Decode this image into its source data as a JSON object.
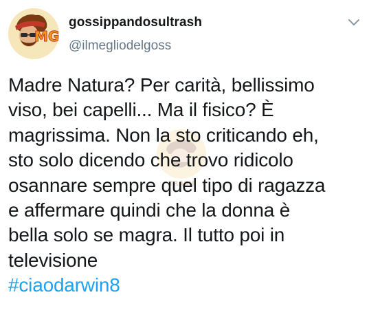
{
  "tweet": {
    "display_name": "gossippandosultrash",
    "handle": "@ilmegliodelgoss",
    "avatar_icon": "avatar-logo-mg",
    "menu_icon": "chevron-down-icon",
    "avatar_text": "MG",
    "body_lines": [
      "Madre Natura? Per carità, bellissimo",
      "viso, bei capelli... Ma il fisico? È",
      "magrissima. Non la sto criticando eh,",
      "sto solo dicendo che trovo ridicolo",
      "osannare sempre quel tipo di ragazza",
      "e affermare quindi che la donna è",
      "bella solo se magra. Il tutto poi in",
      "televisione"
    ],
    "hashtag": "#ciaodarwin8",
    "hashtag_color": "#1da1f2"
  },
  "watermark": {
    "text": "TRASH"
  }
}
